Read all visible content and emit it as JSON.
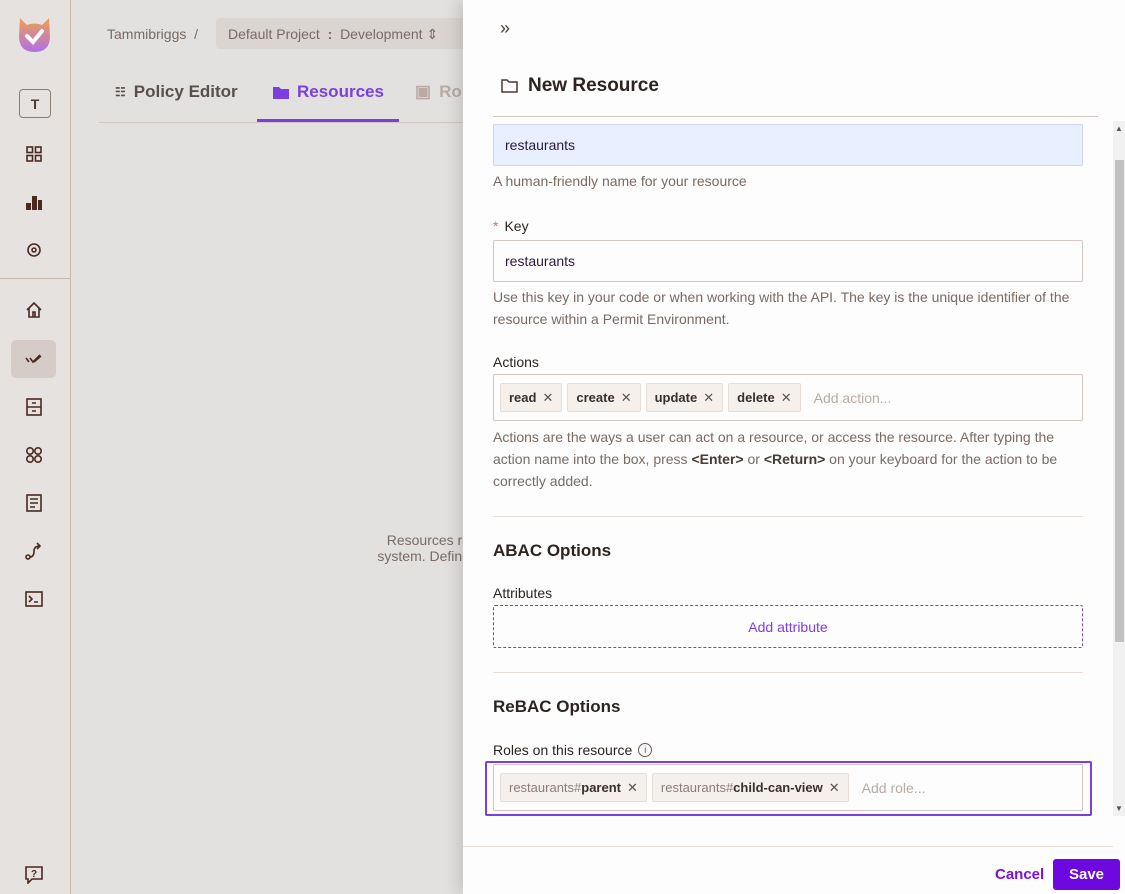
{
  "sidebar": {
    "workspace_initial": "T",
    "icons": [
      "dashboard-icon",
      "bar-chart-icon",
      "settings-icon",
      "home-icon",
      "policy-icon",
      "archive-icon",
      "apps-icon",
      "document-icon",
      "route-icon",
      "terminal-icon",
      "help-icon"
    ],
    "active": "policy-icon"
  },
  "header": {
    "breadcrumb_org": "Tammibriggs",
    "breadcrumb_sep": "/",
    "project": "Default Project",
    "project_sep": ":",
    "environment": "Development"
  },
  "tabs": [
    {
      "label": "Policy Editor"
    },
    {
      "label": "Resources",
      "active": true
    },
    {
      "label": "Roles"
    }
  ],
  "empty_state": {
    "line1": "Resources re",
    "line2": "system. Define"
  },
  "panel": {
    "title": "New Resource",
    "name_value": "restaurants",
    "name_help": "A human-friendly name for your resource",
    "key_label": "Key",
    "key_required": "*",
    "key_value": "restaurants",
    "key_help": "Use this key in your code or when working with the API. The key is the unique identifier of the resource within a Permit Environment.",
    "actions_label": "Actions",
    "actions": [
      "read",
      "create",
      "update",
      "delete"
    ],
    "actions_placeholder": "Add action...",
    "actions_help_1": "Actions are the ways a user can act on a resource, or access the resource. After typing the action name into the box, press ",
    "actions_help_enter": "<Enter>",
    "actions_help_or": " or ",
    "actions_help_return": "<Return>",
    "actions_help_2": " on your keyboard for the action to be correctly added.",
    "abac_title": "ABAC Options",
    "attributes_label": "Attributes",
    "add_attribute": "Add attribute",
    "rebac_title": "ReBAC Options",
    "roles_label": "Roles on this resource",
    "roles": [
      {
        "prefix": "restaurants#",
        "name": "parent"
      },
      {
        "prefix": "restaurants#",
        "name": "child-can-view"
      }
    ],
    "roles_placeholder": "Add role...",
    "cancel": "Cancel",
    "save": "Save"
  },
  "colors": {
    "accent": "#7b3fe0",
    "save_button": "#6d08e0"
  }
}
